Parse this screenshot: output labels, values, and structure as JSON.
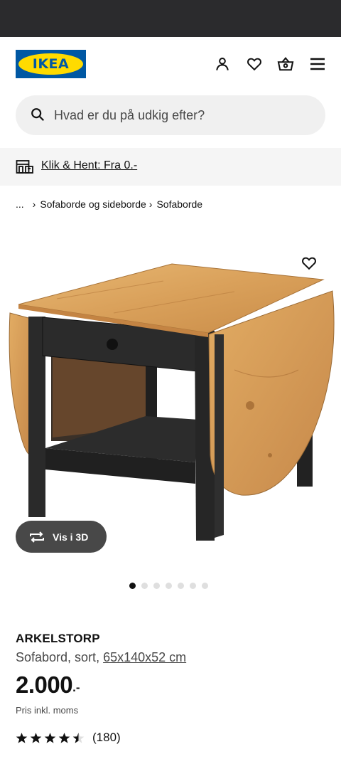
{
  "header": {
    "logo_text": "IKEA",
    "icons": [
      "account-icon",
      "heart-icon",
      "basket-icon",
      "menu-icon"
    ]
  },
  "search": {
    "placeholder": "Hvad er du på udkig efter?"
  },
  "promo": {
    "text": "Klik & Hent: Fra 0.-",
    "icon": "store-pickup-icon"
  },
  "breadcrumb": {
    "ellipsis": "...",
    "items": [
      "Sofaborde og sideborde",
      "Sofaborde"
    ]
  },
  "gallery": {
    "view3d_label": "Vis i 3D",
    "image_count": 7,
    "active_index": 0
  },
  "product": {
    "name": "ARKELSTORP",
    "description": "Sofabord, sort, ",
    "dimensions": "65x140x52 cm",
    "price_integer": "2.000",
    "price_decimal": ".-",
    "vat_note": "Pris inkl. moms",
    "rating": 4.5,
    "rating_max": 5,
    "review_count": "(180)"
  },
  "colors": {
    "ikea_blue": "#0058a3",
    "ikea_yellow": "#ffdb00",
    "status_bar": "#2b2b2d"
  }
}
